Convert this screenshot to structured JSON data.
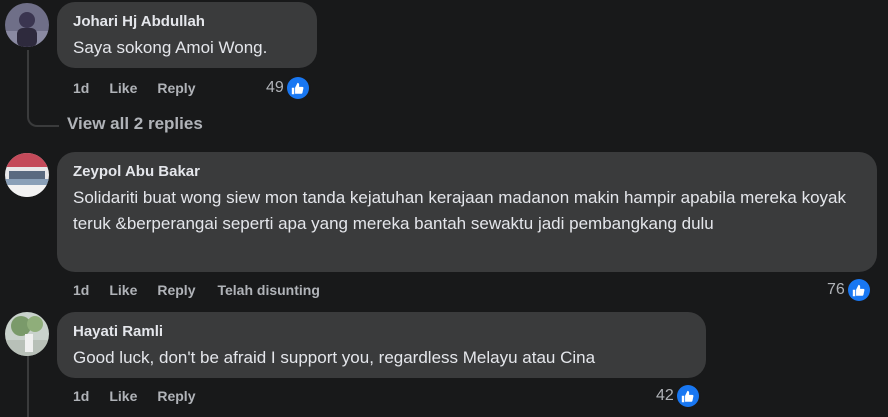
{
  "comments": [
    {
      "author": "Johari Hj Abdullah",
      "text": "Saya sokong Amoi Wong.",
      "time": "1d",
      "like": "Like",
      "reply": "Reply",
      "edited": "",
      "reactions": "49",
      "view_replies": "View all 2 replies"
    },
    {
      "author": "Zeypol Abu Bakar",
      "text": "Solidariti buat wong siew mon tanda kejatuhan kerajaan madanon makin hampir apabila mereka koyak teruk &berperangai seperti apa yang mereka bantah sewaktu jadi pembangkang dulu",
      "time": "1d",
      "like": "Like",
      "reply": "Reply",
      "edited": "Telah disunting",
      "reactions": "76"
    },
    {
      "author": "Hayati Ramli",
      "text": "Good luck, don't be afraid I support you, regardless Melayu atau Cina",
      "time": "1d",
      "like": "Like",
      "reply": "Reply",
      "edited": "",
      "reactions": "42"
    }
  ],
  "colors": {
    "background": "#18191a",
    "bubble": "#3a3b3c",
    "like_blue": "#1877f2",
    "secondary_text": "#b0b3b8"
  },
  "icons": {
    "reaction": "thumbs-up-icon"
  }
}
